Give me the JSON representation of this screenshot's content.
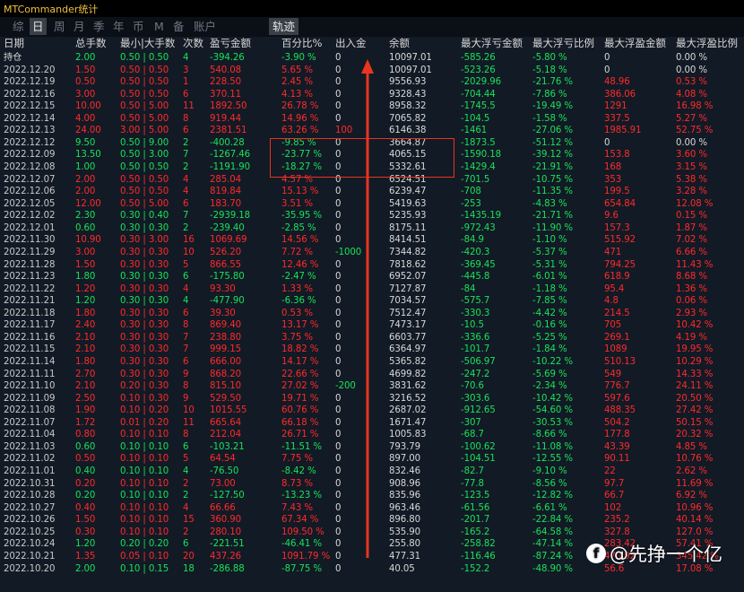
{
  "window": {
    "title": "MTCommander统计"
  },
  "tabs": [
    {
      "label": "综"
    },
    {
      "label": "日",
      "active": true
    },
    {
      "label": "周"
    },
    {
      "label": "月"
    },
    {
      "label": "季"
    },
    {
      "label": "年"
    },
    {
      "label": "币"
    },
    {
      "label": "M"
    },
    {
      "label": "备"
    },
    {
      "label": "账户"
    }
  ],
  "track_button": {
    "label": "轨迹"
  },
  "table": {
    "headers": [
      "日期",
      "总手数",
      "最小|大手数",
      "次数",
      "盈亏金额",
      "百分比%",
      "出入金",
      "余额",
      "最大浮亏金额",
      "最大浮亏比例",
      "最大浮盈金额",
      "最大浮盈比例"
    ],
    "rows": [
      [
        "持仓",
        "2.00",
        "0.50 | 0.50",
        "4",
        "-394.26",
        "-3.90 %",
        "0",
        "10097.01",
        "-585.26",
        "-5.80 %",
        "0",
        "0.00 %"
      ],
      [
        "2022.12.20",
        "1.50",
        "0.50 | 0.50",
        "3",
        "540.08",
        "5.65 %",
        "0",
        "10097.01",
        "-523.26",
        "-5.18 %",
        "0",
        "0.00 %"
      ],
      [
        "2022.12.19",
        "0.50",
        "0.50 | 0.50",
        "1",
        "228.50",
        "2.45 %",
        "0",
        "9556.93",
        "-2029.96",
        "-21.76 %",
        "48.96",
        "0.53 %"
      ],
      [
        "2022.12.16",
        "3.00",
        "0.50 | 0.50",
        "6",
        "370.11",
        "4.13 %",
        "0",
        "9328.43",
        "-704.44",
        "-7.86 %",
        "386.06",
        "4.08 %"
      ],
      [
        "2022.12.15",
        "10.00",
        "0.50 | 5.00",
        "11",
        "1892.50",
        "26.78 %",
        "0",
        "8958.32",
        "-1745.5",
        "-19.49 %",
        "1291",
        "16.98 %"
      ],
      [
        "2022.12.14",
        "4.00",
        "0.50 | 5.00",
        "8",
        "919.44",
        "14.96 %",
        "0",
        "7065.82",
        "-104.5",
        "-1.58 %",
        "337.5",
        "5.27 %"
      ],
      [
        "2022.12.13",
        "24.00",
        "3.00 | 5.00",
        "6",
        "2381.51",
        "63.26 %",
        "100",
        "6146.38",
        "-1461",
        "-27.06 %",
        "1985.91",
        "52.75 %"
      ],
      [
        "2022.12.12",
        "9.50",
        "0.50 | 9.00",
        "2",
        "-400.28",
        "-9.85 %",
        "0",
        "3664.87",
        "-1873.5",
        "-51.12 %",
        "0",
        "0.00 %"
      ],
      [
        "2022.12.09",
        "13.50",
        "0.50 | 3.00",
        "7",
        "-1267.46",
        "-23.77 %",
        "0",
        "4065.15",
        "-1590.18",
        "-39.12 %",
        "153.8",
        "3.60 %"
      ],
      [
        "2022.12.08",
        "1.00",
        "0.50 | 0.50",
        "2",
        "-1191.90",
        "-18.27 %",
        "0",
        "5332.61",
        "-1429.4",
        "-21.91 %",
        "168",
        "3.15 %"
      ],
      [
        "2022.12.07",
        "2.00",
        "0.50 | 0.50",
        "4",
        "285.04",
        "4.57 %",
        "0",
        "6524.51",
        "-701.5",
        "-10.75 %",
        "353",
        "5.38 %"
      ],
      [
        "2022.12.06",
        "2.00",
        "0.50 | 0.50",
        "4",
        "819.84",
        "15.13 %",
        "0",
        "6239.47",
        "-708",
        "-11.35 %",
        "199.5",
        "3.28 %"
      ],
      [
        "2022.12.05",
        "12.00",
        "0.50 | 5.00",
        "6",
        "183.70",
        "3.51 %",
        "0",
        "5419.63",
        "-253",
        "-4.83 %",
        "654.84",
        "12.08 %"
      ],
      [
        "2022.12.02",
        "2.30",
        "0.30 | 0.40",
        "7",
        "-2939.18",
        "-35.95 %",
        "0",
        "5235.93",
        "-1435.19",
        "-21.71 %",
        "9.6",
        "0.15 %"
      ],
      [
        "2022.12.01",
        "0.60",
        "0.30 | 0.30",
        "2",
        "-239.40",
        "-2.85 %",
        "0",
        "8175.11",
        "-972.43",
        "-11.90 %",
        "157.3",
        "1.87 %"
      ],
      [
        "2022.11.30",
        "10.90",
        "0.30 | 3.00",
        "16",
        "1069.69",
        "14.56 %",
        "0",
        "8414.51",
        "-84.9",
        "-1.10 %",
        "515.92",
        "7.02 %"
      ],
      [
        "2022.11.29",
        "3.00",
        "0.30 | 0.30",
        "10",
        "526.20",
        "7.72 %",
        "-1000",
        "7344.82",
        "-420.3",
        "-5.37 %",
        "471",
        "6.66 %"
      ],
      [
        "2022.11.28",
        "1.50",
        "0.30 | 0.30",
        "5",
        "866.55",
        "12.46 %",
        "0",
        "7818.62",
        "-369.45",
        "-5.31 %",
        "794.25",
        "11.43 %"
      ],
      [
        "2022.11.23",
        "1.80",
        "0.30 | 0.30",
        "6",
        "-175.80",
        "-2.47 %",
        "0",
        "6952.07",
        "-445.8",
        "-6.01 %",
        "618.9",
        "8.68 %"
      ],
      [
        "2022.11.22",
        "1.20",
        "0.30 | 0.30",
        "4",
        "93.30",
        "1.33 %",
        "0",
        "7127.87",
        "-84",
        "-1.18 %",
        "95.4",
        "1.36 %"
      ],
      [
        "2022.11.21",
        "1.20",
        "0.30 | 0.30",
        "4",
        "-477.90",
        "-6.36 %",
        "0",
        "7034.57",
        "-575.7",
        "-7.85 %",
        "4.8",
        "0.06 %"
      ],
      [
        "2022.11.18",
        "1.80",
        "0.30 | 0.30",
        "6",
        "39.30",
        "0.53 %",
        "0",
        "7512.47",
        "-330.3",
        "-4.42 %",
        "214.5",
        "2.93 %"
      ],
      [
        "2022.11.17",
        "2.40",
        "0.30 | 0.30",
        "8",
        "869.40",
        "13.17 %",
        "0",
        "7473.17",
        "-10.5",
        "-0.16 %",
        "705",
        "10.42 %"
      ],
      [
        "2022.11.16",
        "2.10",
        "0.30 | 0.30",
        "7",
        "238.80",
        "3.75 %",
        "0",
        "6603.77",
        "-336.6",
        "-5.25 %",
        "269.1",
        "4.19 %"
      ],
      [
        "2022.11.15",
        "2.10",
        "0.30 | 0.30",
        "7",
        "999.15",
        "18.82 %",
        "0",
        "6364.97",
        "-101.7",
        "-1.84 %",
        "1089",
        "19.95 %"
      ],
      [
        "2022.11.14",
        "1.80",
        "0.30 | 0.30",
        "6",
        "666.00",
        "14.17 %",
        "0",
        "5365.82",
        "-506.97",
        "-10.22 %",
        "510.13",
        "10.29 %"
      ],
      [
        "2022.11.11",
        "2.70",
        "0.30 | 0.30",
        "9",
        "868.20",
        "22.66 %",
        "0",
        "4699.82",
        "-247.2",
        "-5.69 %",
        "549",
        "14.33 %"
      ],
      [
        "2022.11.10",
        "2.10",
        "0.20 | 0.30",
        "8",
        "815.10",
        "27.02 %",
        "-200",
        "3831.62",
        "-70.6",
        "-2.34 %",
        "776.7",
        "24.11 %"
      ],
      [
        "2022.11.09",
        "2.50",
        "0.10 | 0.30",
        "9",
        "529.50",
        "19.71 %",
        "0",
        "3216.52",
        "-303.6",
        "-10.42 %",
        "597.6",
        "20.50 %"
      ],
      [
        "2022.11.08",
        "1.90",
        "0.10 | 0.20",
        "10",
        "1015.55",
        "60.76 %",
        "0",
        "2687.02",
        "-912.65",
        "-54.60 %",
        "488.35",
        "27.42 %"
      ],
      [
        "2022.11.07",
        "1.72",
        "0.01 | 0.20",
        "11",
        "665.64",
        "66.18 %",
        "0",
        "1671.47",
        "-307",
        "-30.53 %",
        "504.2",
        "50.15 %"
      ],
      [
        "2022.11.04",
        "0.80",
        "0.10 | 0.10",
        "8",
        "212.04",
        "26.71 %",
        "0",
        "1005.83",
        "-68.7",
        "-8.66 %",
        "177.8",
        "20.32 %"
      ],
      [
        "2022.11.03",
        "0.60",
        "0.10 | 0.10",
        "6",
        "-103.21",
        "-11.51 %",
        "0",
        "793.79",
        "-100.62",
        "-11.08 %",
        "43.39",
        "4.85 %"
      ],
      [
        "2022.11.02",
        "0.50",
        "0.10 | 0.10",
        "5",
        "64.54",
        "7.75 %",
        "0",
        "897.00",
        "-104.51",
        "-12.55 %",
        "90.11",
        "10.76 %"
      ],
      [
        "2022.11.01",
        "0.40",
        "0.10 | 0.10",
        "4",
        "-76.50",
        "-8.42 %",
        "0",
        "832.46",
        "-82.7",
        "-9.10 %",
        "22",
        "2.62 %"
      ],
      [
        "2022.10.31",
        "0.20",
        "0.10 | 0.10",
        "2",
        "73.00",
        "8.73 %",
        "0",
        "908.96",
        "-77.8",
        "-8.56 %",
        "97.7",
        "11.69 %"
      ],
      [
        "2022.10.28",
        "0.20",
        "0.10 | 0.10",
        "2",
        "-127.50",
        "-13.23 %",
        "0",
        "835.96",
        "-123.5",
        "-12.82 %",
        "66.7",
        "6.92 %"
      ],
      [
        "2022.10.27",
        "0.40",
        "0.10 | 0.10",
        "4",
        "66.66",
        "7.43 %",
        "0",
        "963.46",
        "-61.56",
        "-6.61 %",
        "102",
        "10.96 %"
      ],
      [
        "2022.10.26",
        "1.50",
        "0.10 | 0.10",
        "15",
        "360.90",
        "67.34 %",
        "0",
        "896.80",
        "-201.7",
        "-22.84 %",
        "235.2",
        "40.14 %"
      ],
      [
        "2022.10.25",
        "0.30",
        "0.10 | 0.10",
        "2",
        "280.10",
        "109.50 %",
        "0",
        "535.90",
        "-165.2",
        "-64.58 %",
        "327.8",
        "127.0 %"
      ],
      [
        "2022.10.24",
        "1.20",
        "0.20 | 0.20",
        "6",
        "-221.51",
        "-46.41 %",
        "0",
        "255.80",
        "-258.82",
        "-47.14 %",
        "283.42",
        "57.41 %"
      ],
      [
        "2022.10.21",
        "1.35",
        "0.05 | 0.10",
        "20",
        "437.26",
        "1091.79 %",
        "0",
        "477.31",
        "-116.46",
        "-87.24 %",
        "470.92",
        "345.42 %"
      ],
      [
        "2022.10.20",
        "2.00",
        "0.10 | 0.15",
        "18",
        "-286.88",
        "-87.75 %",
        "0",
        "40.05",
        "-152.2",
        "-48.90 %",
        "56.6",
        "17.08 %"
      ]
    ]
  },
  "watermark": {
    "logo": "f",
    "text": "@先挣一个亿"
  },
  "colors": {
    "profit": "#ff2a2a",
    "loss": "#19e25a",
    "neutral": "#d8d8d8",
    "highlight": "#e8351e",
    "arrow": "#e8351e",
    "title": "#f0c040"
  }
}
